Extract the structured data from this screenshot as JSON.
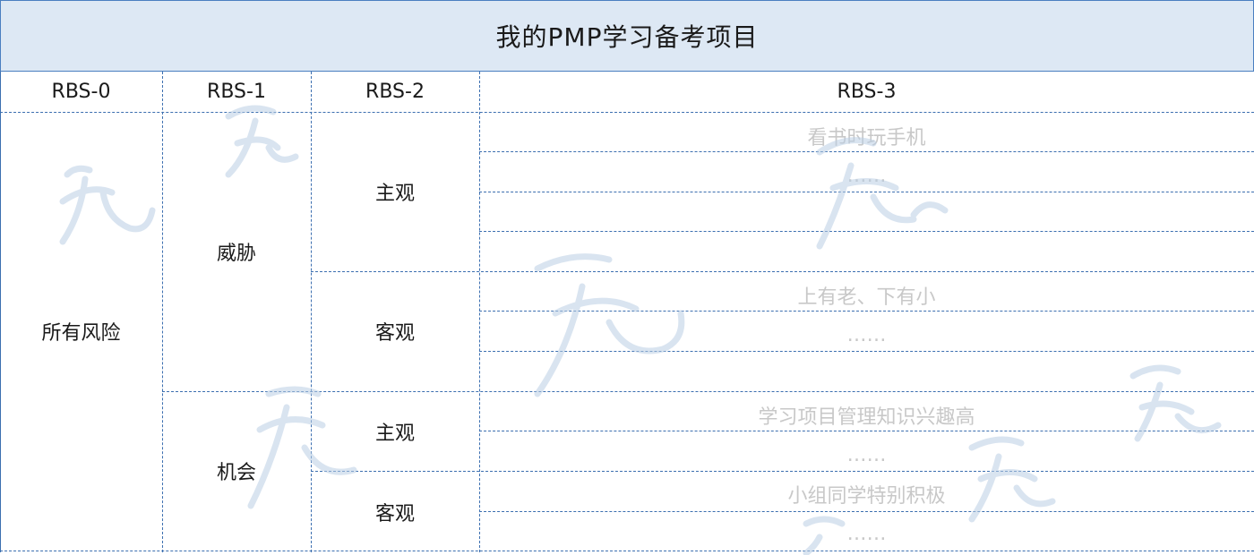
{
  "title": "我的PMP学习备考项目",
  "headers": [
    "RBS-0",
    "RBS-1",
    "RBS-2",
    "RBS-3"
  ],
  "rbs0": "所有风险",
  "threat": {
    "label": "威胁",
    "subjective": {
      "label": "主观",
      "items": [
        "看书时玩手机",
        "……"
      ]
    },
    "objective": {
      "label": "客观",
      "items": [
        "上有老、下有小",
        "……"
      ]
    }
  },
  "opportunity": {
    "label": "机会",
    "subjective": {
      "label": "主观",
      "items": [
        "学习项目管理知识兴趣高",
        "……"
      ]
    },
    "objective": {
      "label": "客观",
      "items": [
        "小组同学特别积极",
        "……"
      ]
    }
  },
  "colors": {
    "header_bg": "#dde8f4",
    "grid": "#3c6fb0",
    "faded_text": "#c8c8c8",
    "watermark": "#9fb9d6"
  }
}
